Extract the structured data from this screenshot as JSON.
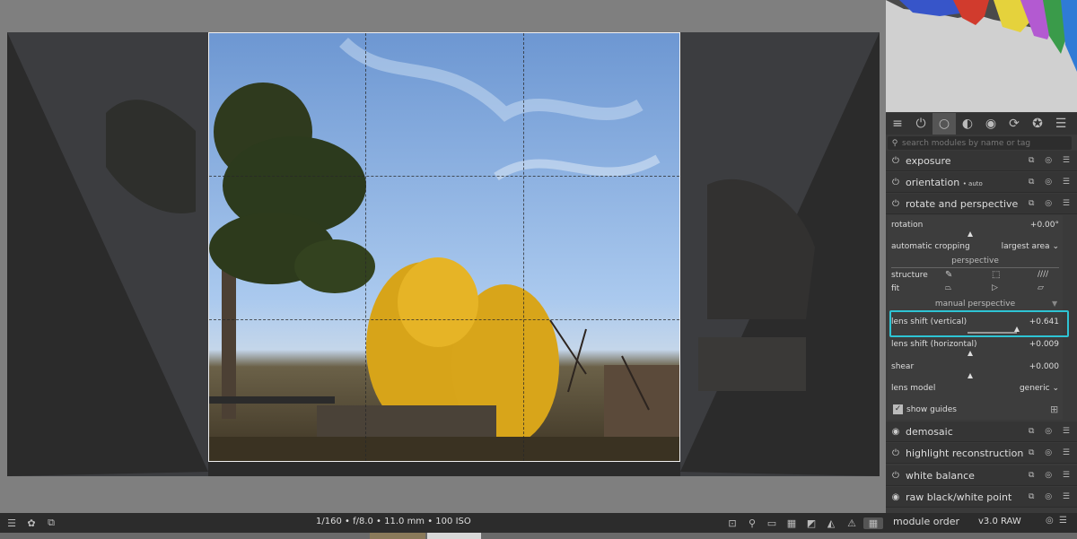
{
  "modules_tabs": [
    "≡",
    "⏻",
    "○",
    "◐",
    "◉",
    "⟳",
    "✪",
    "☰"
  ],
  "search": {
    "placeholder": "search modules by name or tag"
  },
  "modules": {
    "exposure": "exposure",
    "orientation": "orientation",
    "orientation_sub": "• auto",
    "rotate": "rotate and perspective",
    "demosaic": "demosaic",
    "highlight": "highlight reconstruction",
    "white_balance": "white balance",
    "raw_bw": "raw black/white point"
  },
  "rotate_module": {
    "rotation_label": "rotation",
    "rotation_value": "+0.00°",
    "auto_crop_label": "automatic cropping",
    "auto_crop_value": "largest area",
    "perspective_title": "perspective",
    "structure_label": "structure",
    "fit_label": "fit",
    "manual_title": "manual perspective",
    "lens_v_label": "lens shift (vertical)",
    "lens_v_value": "+0.641",
    "lens_h_label": "lens shift (horizontal)",
    "lens_h_value": "+0.009",
    "shear_label": "shear",
    "shear_value": "+0.000",
    "lens_model_label": "lens model",
    "lens_model_value": "generic",
    "show_guides_label": "show guides"
  },
  "footer": {
    "exif": "1/160 • f/8.0 • 11.0 mm • 100 ISO",
    "module_order_label": "module order",
    "module_order_value": "v3.0 RAW"
  },
  "colors": {
    "highlight_box": "#2ec4d4"
  }
}
